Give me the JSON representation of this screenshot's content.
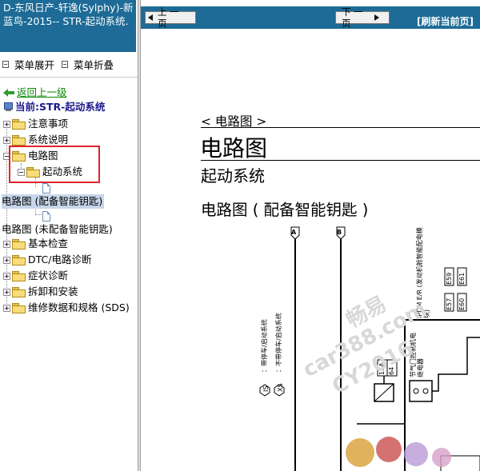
{
  "left": {
    "title": "D-东风日产-轩逸(Sylphy)-新蓝鸟-2015-- STR-起动系统.",
    "menu_expand": "菜单展开",
    "menu_collapse": "菜单折叠",
    "back": "返回上一级",
    "current": "当前:STR-起动系统",
    "tree": [
      {
        "label": "注意事项"
      },
      {
        "label": "系统说明"
      },
      {
        "label": "电路图"
      },
      {
        "label": "起动系统"
      },
      {
        "label": "电路图 (配备智能钥匙)"
      },
      {
        "label": "电路图 (未配备智能钥匙)"
      },
      {
        "label": "基本检查"
      },
      {
        "label": "DTC/电路诊断"
      },
      {
        "label": "症状诊断"
      },
      {
        "label": "拆卸和安装"
      },
      {
        "label": "维修数据和规格 (SDS)"
      }
    ]
  },
  "toolbar": {
    "prev": "上 一 页",
    "next": "下 一 页",
    "refresh": "[刷新当前页]"
  },
  "document": {
    "breadcrumb": "< 电路图 >",
    "heading": "电路图",
    "subheading": "起动系统",
    "section_title": "电路图 ( 配备智能钥匙 )",
    "connector_a": "A",
    "connector_b": "B",
    "legend_is": "IS",
    "legend_xs": "XS",
    "legend_is_text": "：带停车/启动系统",
    "legend_xs_text": "：不带停车/启动系统",
    "ipdm_label": "IPDM E/R (发动机舱智能配电模块)",
    "conn_e59": "E59",
    "conn_e61": "E61",
    "conn_e57": "E57",
    "conn_e60": "E60",
    "fuse_15a": "15A",
    "fuse_64": "64",
    "relay_label": "节气门控制机电继电器",
    "watermark_1": "畅易",
    "watermark_2": "car388.com",
    "watermark_3": "CY2016"
  }
}
